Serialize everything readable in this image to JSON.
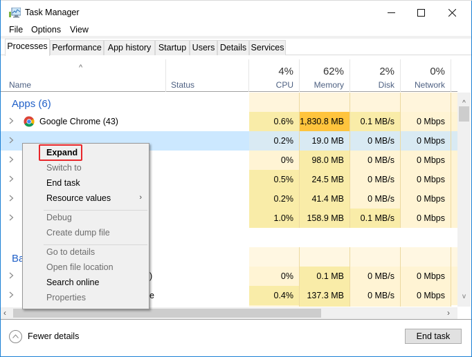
{
  "window": {
    "title": "Task Manager",
    "controls": {
      "minimize": "—",
      "maximize": "☐",
      "close": "✕"
    }
  },
  "menu": [
    "File",
    "Options",
    "View"
  ],
  "tabs": [
    {
      "label": "Processes",
      "active": true
    },
    {
      "label": "Performance",
      "active": false
    },
    {
      "label": "App history",
      "active": false
    },
    {
      "label": "Startup",
      "active": false
    },
    {
      "label": "Users",
      "active": false
    },
    {
      "label": "Details",
      "active": false
    },
    {
      "label": "Services",
      "active": false
    }
  ],
  "columns": {
    "name": "Name",
    "status": "Status",
    "cpu": {
      "label": "CPU",
      "percent": "4%"
    },
    "memory": {
      "label": "Memory",
      "percent": "62%"
    },
    "disk": {
      "label": "Disk",
      "percent": "2%"
    },
    "network": {
      "label": "Network",
      "percent": "0%"
    }
  },
  "groups": {
    "apps": "Apps (6)",
    "background": "Ba"
  },
  "rows": [
    {
      "name": "Google Chrome (43)",
      "icon": "chrome-icon",
      "cpu": "0.6%",
      "memory": "1,830.8 MB",
      "disk": "0.1 MB/s",
      "network": "0 Mbps"
    },
    {
      "name": "",
      "icon": "",
      "cpu": "0.2%",
      "memory": "19.0 MB",
      "disk": "0 MB/s",
      "network": "0 Mbps",
      "selected": true
    },
    {
      "name": "",
      "icon": "",
      "cpu": "0%",
      "memory": "98.0 MB",
      "disk": "0 MB/s",
      "network": "0 Mbps"
    },
    {
      "name": "",
      "icon": "",
      "cpu": "0.5%",
      "memory": "24.5 MB",
      "disk": "0 MB/s",
      "network": "0 Mbps"
    },
    {
      "name": "",
      "icon": "",
      "cpu": "0.2%",
      "memory": "41.4 MB",
      "disk": "0 MB/s",
      "network": "0 Mbps"
    },
    {
      "name": "",
      "icon": "",
      "cpu": "1.0%",
      "memory": "158.9 MB",
      "disk": "0.1 MB/s",
      "network": "0 Mbps"
    },
    {
      "name": ")",
      "icon": "",
      "cpu": "0%",
      "memory": "0.1 MB",
      "disk": "0 MB/s",
      "network": "0 Mbps"
    },
    {
      "name": "e",
      "icon": "",
      "cpu": "0.4%",
      "memory": "137.3 MB",
      "disk": "0 MB/s",
      "network": "0 Mbps"
    }
  ],
  "context_menu": {
    "items": [
      {
        "label": "Expand",
        "enabled": true,
        "bold": true,
        "highlighted": true
      },
      {
        "label": "Switch to",
        "enabled": false
      },
      {
        "label": "End task",
        "enabled": true
      },
      {
        "label": "Resource values",
        "enabled": true,
        "submenu": true
      },
      {
        "separator": true
      },
      {
        "label": "Debug",
        "enabled": false
      },
      {
        "label": "Create dump file",
        "enabled": false
      },
      {
        "separator": true
      },
      {
        "label": "Go to details",
        "enabled": false
      },
      {
        "label": "Open file location",
        "enabled": false
      },
      {
        "label": "Search online",
        "enabled": true
      },
      {
        "label": "Properties",
        "enabled": false
      }
    ]
  },
  "footer": {
    "fewer_details": "Fewer details",
    "end_task": "End task"
  },
  "colors": {
    "accent": "#1a7fd4",
    "group_title": "#2060c8",
    "selection": "#cce8ff",
    "highlight_box": "#e8262a",
    "heat_light": "#fff4d4",
    "heat_mid": "#f9eca8",
    "heat_strong": "#ffc43d"
  }
}
